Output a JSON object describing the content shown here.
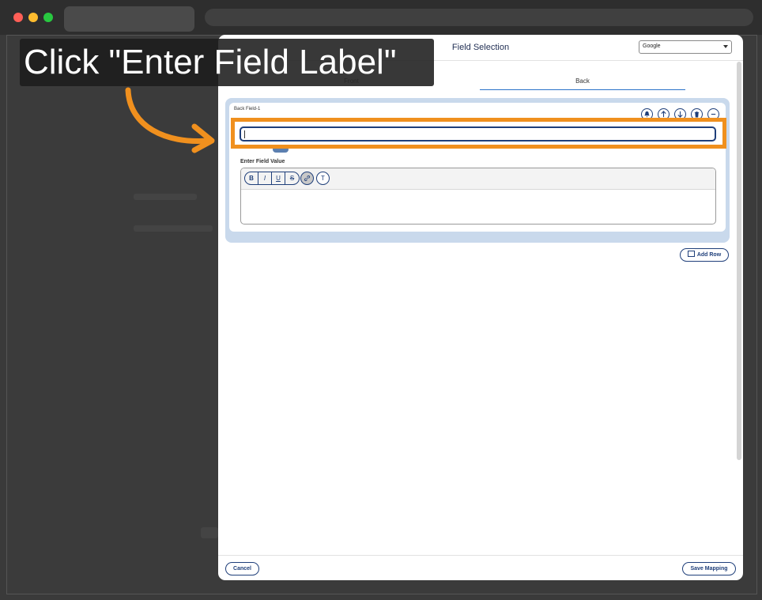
{
  "modal": {
    "title": "Field Selection",
    "language_select": {
      "selected": "Google"
    },
    "tabs": [
      {
        "label": "Front",
        "active": false
      },
      {
        "label": "Back",
        "active": true
      }
    ],
    "field": {
      "name": "Back Field-1",
      "label_input": {
        "value": ""
      },
      "value_label": "Enter Field Value",
      "toolbar": {
        "bold": "B",
        "italic": "I",
        "underline": "U",
        "strike": "S",
        "clear": "T"
      }
    },
    "add_row_label": "Add Row",
    "footer": {
      "cancel_label": "Cancel",
      "save_label": "Save Mapping"
    }
  },
  "callout": {
    "text": "Click \"Enter Field Label\""
  },
  "colors": {
    "highlight": "#f0901e",
    "accent": "#1f3f7a",
    "tab_underline": "#2a72c9"
  }
}
